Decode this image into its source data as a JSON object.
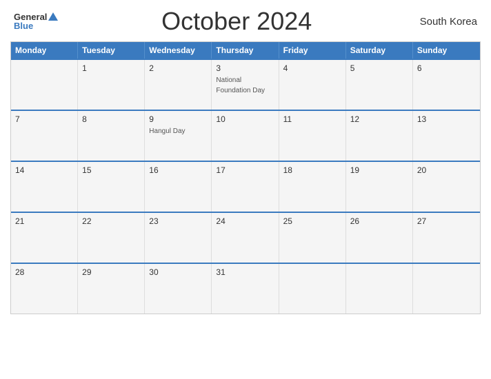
{
  "header": {
    "title": "October 2024",
    "country": "South Korea",
    "logo": {
      "general": "General",
      "blue": "Blue"
    }
  },
  "weekdays": [
    "Monday",
    "Tuesday",
    "Wednesday",
    "Thursday",
    "Friday",
    "Saturday",
    "Sunday"
  ],
  "weeks": [
    [
      {
        "day": "",
        "holiday": ""
      },
      {
        "day": "1",
        "holiday": ""
      },
      {
        "day": "2",
        "holiday": ""
      },
      {
        "day": "3",
        "holiday": "National Foundation Day"
      },
      {
        "day": "4",
        "holiday": ""
      },
      {
        "day": "5",
        "holiday": ""
      },
      {
        "day": "6",
        "holiday": ""
      }
    ],
    [
      {
        "day": "7",
        "holiday": ""
      },
      {
        "day": "8",
        "holiday": ""
      },
      {
        "day": "9",
        "holiday": "Hangul Day"
      },
      {
        "day": "10",
        "holiday": ""
      },
      {
        "day": "11",
        "holiday": ""
      },
      {
        "day": "12",
        "holiday": ""
      },
      {
        "day": "13",
        "holiday": ""
      }
    ],
    [
      {
        "day": "14",
        "holiday": ""
      },
      {
        "day": "15",
        "holiday": ""
      },
      {
        "day": "16",
        "holiday": ""
      },
      {
        "day": "17",
        "holiday": ""
      },
      {
        "day": "18",
        "holiday": ""
      },
      {
        "day": "19",
        "holiday": ""
      },
      {
        "day": "20",
        "holiday": ""
      }
    ],
    [
      {
        "day": "21",
        "holiday": ""
      },
      {
        "day": "22",
        "holiday": ""
      },
      {
        "day": "23",
        "holiday": ""
      },
      {
        "day": "24",
        "holiday": ""
      },
      {
        "day": "25",
        "holiday": ""
      },
      {
        "day": "26",
        "holiday": ""
      },
      {
        "day": "27",
        "holiday": ""
      }
    ],
    [
      {
        "day": "28",
        "holiday": ""
      },
      {
        "day": "29",
        "holiday": ""
      },
      {
        "day": "30",
        "holiday": ""
      },
      {
        "day": "31",
        "holiday": ""
      },
      {
        "day": "",
        "holiday": ""
      },
      {
        "day": "",
        "holiday": ""
      },
      {
        "day": "",
        "holiday": ""
      }
    ]
  ]
}
